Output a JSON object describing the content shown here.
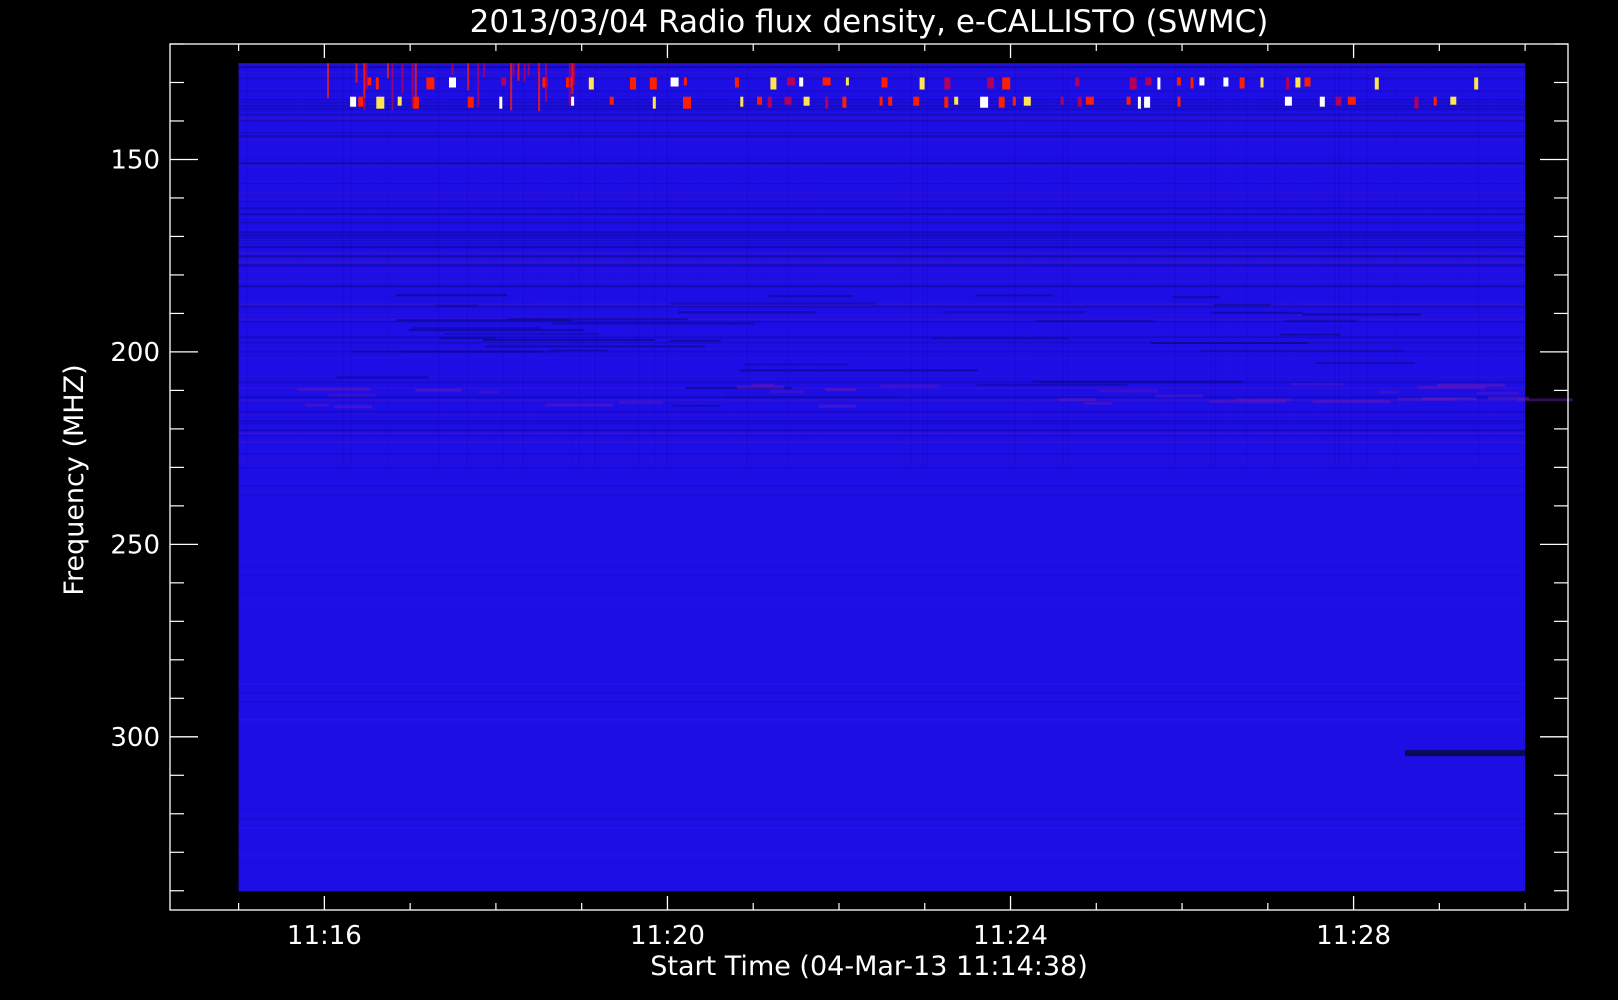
{
  "chart_data": {
    "type": "heatmap",
    "title": "2013/03/04  Radio flux density, e-CALLISTO (SWMC)",
    "xlabel": "Start Time (04-Mar-13 11:14:38)",
    "ylabel": "Frequency (MHZ)",
    "x_tick_labels": [
      "11:16",
      "11:20",
      "11:24",
      "11:28"
    ],
    "x_ticks_minutes": [
      16,
      20,
      24,
      28
    ],
    "x_range_minutes": [
      14.2,
      30.5
    ],
    "data_x_range_minutes": [
      15.0,
      30.0
    ],
    "y_tick_labels": [
      "150",
      "200",
      "250",
      "300"
    ],
    "y_ticks": [
      150,
      200,
      250,
      300
    ],
    "y_range": [
      120,
      345
    ],
    "data_y_range": [
      125,
      340
    ],
    "y_inverted": true,
    "colormap": {
      "background": "#1e0ee6",
      "low": "#0a0a8c",
      "mid": "#b4005a",
      "high": "#ff1e00",
      "peak": "#ffe650",
      "max": "#ffffff"
    },
    "features": [
      {
        "label": "interference bursts",
        "freq": 130,
        "time_range": [
          16.5,
          29.5
        ]
      },
      {
        "label": "interference bursts",
        "freq": 135,
        "time_range": [
          16.3,
          29.3
        ]
      },
      {
        "label": "dark band",
        "freq": 304,
        "time_range": [
          28.6,
          30.0
        ]
      }
    ]
  }
}
